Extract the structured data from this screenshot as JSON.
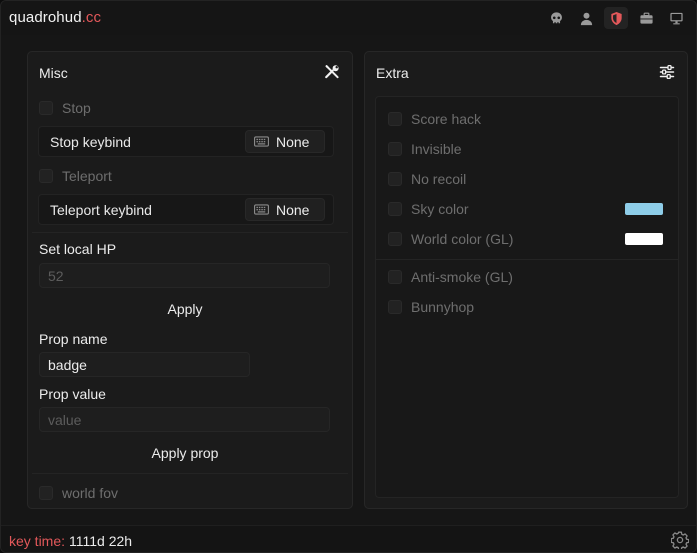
{
  "brand": {
    "name": "quadrohud",
    "suffix": ".cc"
  },
  "nav_icons": [
    "skull-icon",
    "user-icon",
    "shield-icon",
    "briefcase-icon",
    "monitor-icon"
  ],
  "misc": {
    "title": "Misc",
    "stop": {
      "label": "Stop"
    },
    "stop_keybind": {
      "label": "Stop keybind",
      "value": "None"
    },
    "teleport": {
      "label": "Teleport"
    },
    "teleport_keybind": {
      "label": "Teleport keybind",
      "value": "None"
    },
    "local_hp": {
      "label": "Set local HP",
      "placeholder": "52",
      "apply_label": "Apply"
    },
    "prop_name": {
      "label": "Prop name",
      "value": "badge"
    },
    "prop_value": {
      "label": "Prop value",
      "placeholder": "value",
      "apply_label": "Apply prop"
    },
    "world_fov": {
      "label": "world fov"
    }
  },
  "extra": {
    "title": "Extra",
    "items": [
      {
        "label": "Score hack"
      },
      {
        "label": "Invisible"
      },
      {
        "label": "No recoil"
      },
      {
        "label": "Sky color",
        "color": "#8ecde8"
      },
      {
        "label": "World color (GL)",
        "color": "#ffffff"
      },
      {
        "label": "Anti-smoke (GL)"
      },
      {
        "label": "Bunnyhop"
      }
    ]
  },
  "footer": {
    "key_label": "key time:",
    "key_value": "1111d 22h"
  },
  "colors": {
    "accent": "#e2585a",
    "panel": "#1b1b1b",
    "background": "#161616"
  }
}
